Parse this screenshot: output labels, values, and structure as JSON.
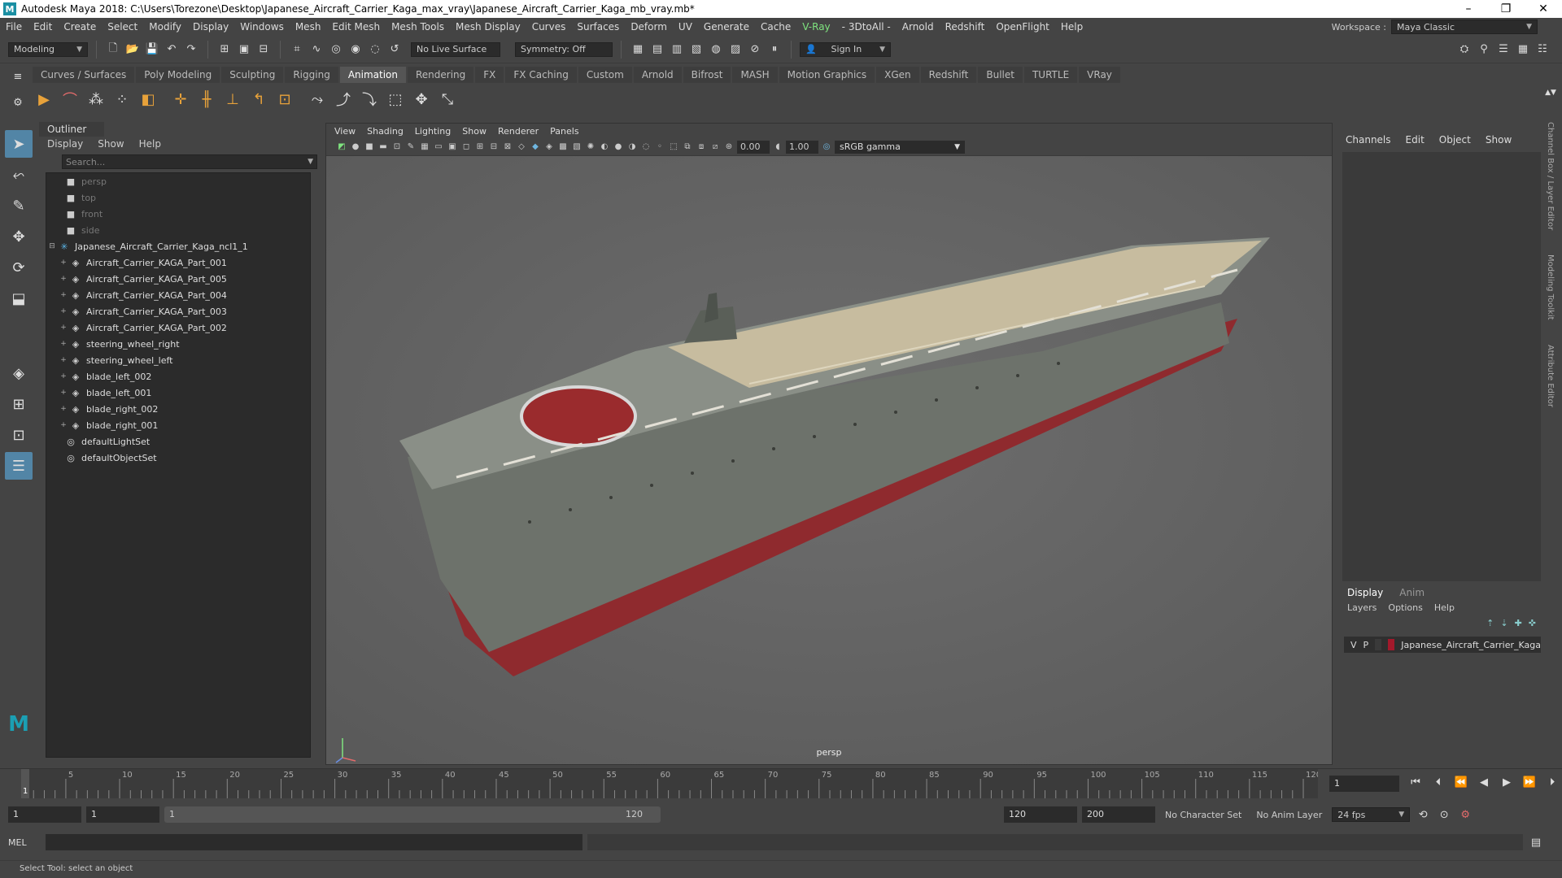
{
  "window": {
    "title": "Autodesk Maya 2018: C:\\Users\\Torezone\\Desktop\\Japanese_Aircraft_Carrier_Kaga_max_vray\\Japanese_Aircraft_Carrier_Kaga_mb_vray.mb*",
    "logo": "M"
  },
  "menubar": {
    "items": [
      "File",
      "Edit",
      "Create",
      "Select",
      "Modify",
      "Display",
      "Windows",
      "Mesh",
      "Edit Mesh",
      "Mesh Tools",
      "Mesh Display",
      "Curves",
      "Surfaces",
      "Deform",
      "UV",
      "Generate",
      "Cache"
    ],
    "vray": "V-Ray",
    "items2": [
      "- 3DtoAll -",
      "Arnold",
      "Redshift",
      "OpenFlight",
      "Help"
    ],
    "workspace_label": "Workspace :",
    "workspace_value": "Maya Classic"
  },
  "statusline": {
    "mode": "Modeling",
    "live_surface": "No Live Surface",
    "symmetry": "Symmetry: Off",
    "signin": "Sign In"
  },
  "shelf": {
    "tabs": [
      "Curves / Surfaces",
      "Poly Modeling",
      "Sculpting",
      "Rigging",
      "Animation",
      "Rendering",
      "FX",
      "FX Caching",
      "Custom",
      "Arnold",
      "Bifrost",
      "MASH",
      "Motion Graphics",
      "XGen",
      "Redshift",
      "Bullet",
      "TURTLE",
      "VRay"
    ],
    "active": "Animation"
  },
  "outliner": {
    "title": "Outliner",
    "menu": [
      "Display",
      "Show",
      "Help"
    ],
    "search_placeholder": "Search...",
    "cameras": [
      "persp",
      "top",
      "front",
      "side"
    ],
    "root": "Japanese_Aircraft_Carrier_Kaga_ncl1_1",
    "children": [
      "Aircraft_Carrier_KAGA_Part_001",
      "Aircraft_Carrier_KAGA_Part_005",
      "Aircraft_Carrier_KAGA_Part_004",
      "Aircraft_Carrier_KAGA_Part_003",
      "Aircraft_Carrier_KAGA_Part_002",
      "steering_wheel_right",
      "steering_wheel_left",
      "blade_left_002",
      "blade_left_001",
      "blade_right_002",
      "blade_right_001"
    ],
    "sets": [
      "defaultLightSet",
      "defaultObjectSet"
    ]
  },
  "viewport": {
    "menu": [
      "View",
      "Shading",
      "Lighting",
      "Show",
      "Renderer",
      "Panels"
    ],
    "exposure": "0.00",
    "gamma_val": "1.00",
    "color_space": "sRGB gamma",
    "camera_label": "persp"
  },
  "channelbox": {
    "menu": [
      "Channels",
      "Edit",
      "Object",
      "Show"
    ]
  },
  "layers": {
    "tabs": [
      "Display",
      "Anim"
    ],
    "active_tab": "Display",
    "menu": [
      "Layers",
      "Options",
      "Help"
    ],
    "layer_v": "V",
    "layer_p": "P",
    "layer_name": "Japanese_Aircraft_Carrier_Kaga",
    "layer_color": "#a3192b"
  },
  "sidetabs": [
    "Channel Box / Layer Editor",
    "Modeling Toolkit",
    "Attribute Editor"
  ],
  "timeline": {
    "ticks": [
      "5",
      "10",
      "15",
      "20",
      "25",
      "30",
      "35",
      "40",
      "45",
      "50",
      "55",
      "60",
      "65",
      "70",
      "75",
      "80",
      "85",
      "90",
      "95",
      "100",
      "105",
      "110",
      "115",
      "120"
    ],
    "current": "1",
    "current_field": "1"
  },
  "range": {
    "start": "1",
    "start2": "1",
    "slider_start": "1",
    "slider_end": "120",
    "end": "120",
    "end2": "200",
    "charset": "No Character Set",
    "animlayer": "No Anim Layer",
    "fps": "24 fps"
  },
  "cmd": {
    "label": "MEL"
  },
  "help": {
    "text": "Select Tool: select an object"
  }
}
